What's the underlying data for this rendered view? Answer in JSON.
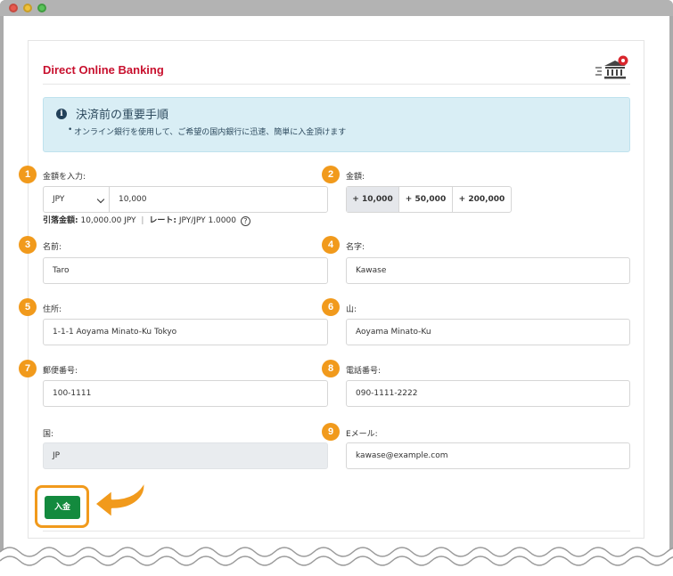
{
  "header": {
    "title": "Direct Online Banking",
    "icon": "bank-icon"
  },
  "notice": {
    "title": "決済前の重要手順",
    "item": "オンライン銀行を使用して、ご希望の国内銀行に迅速、簡単に入金頂けます"
  },
  "badges": [
    "1",
    "2",
    "3",
    "4",
    "5",
    "6",
    "7",
    "8",
    "9"
  ],
  "amount": {
    "label": "金額を入力:",
    "currency": "JPY",
    "value": "10,000",
    "summary_debit_label": "引落金額:",
    "summary_debit_value": "10,000.00 JPY",
    "summary_sep": "|",
    "summary_rate_label": "レート:",
    "summary_rate_value": "JPY/JPY 1.0000",
    "help": "?"
  },
  "quick_amount": {
    "label": "金額:",
    "options": [
      "+ 10,000",
      "+ 50,000",
      "+ 200,000"
    ]
  },
  "fields": {
    "last_name": {
      "label": "名前:",
      "value": "Taro"
    },
    "first_name": {
      "label": "名字:",
      "value": "Kawase"
    },
    "address": {
      "label": "住所:",
      "value": "1-1-1 Aoyama Minato-Ku Tokyo"
    },
    "state": {
      "label": "山:",
      "value": "Aoyama Minato-Ku"
    },
    "zip": {
      "label": "郵便番号:",
      "value": "100-1111"
    },
    "phone": {
      "label": "電話番号:",
      "value": "090-1111-2222"
    },
    "country": {
      "label": "国:",
      "value": "JP"
    },
    "email": {
      "label": "Eメール:",
      "value": "kawase@example.com"
    }
  },
  "submit": {
    "label": "入金"
  },
  "colors": {
    "accent": "#f19a1c",
    "title": "#c8102e",
    "submit": "#138a3e",
    "notice_bg": "#d9eef5"
  }
}
